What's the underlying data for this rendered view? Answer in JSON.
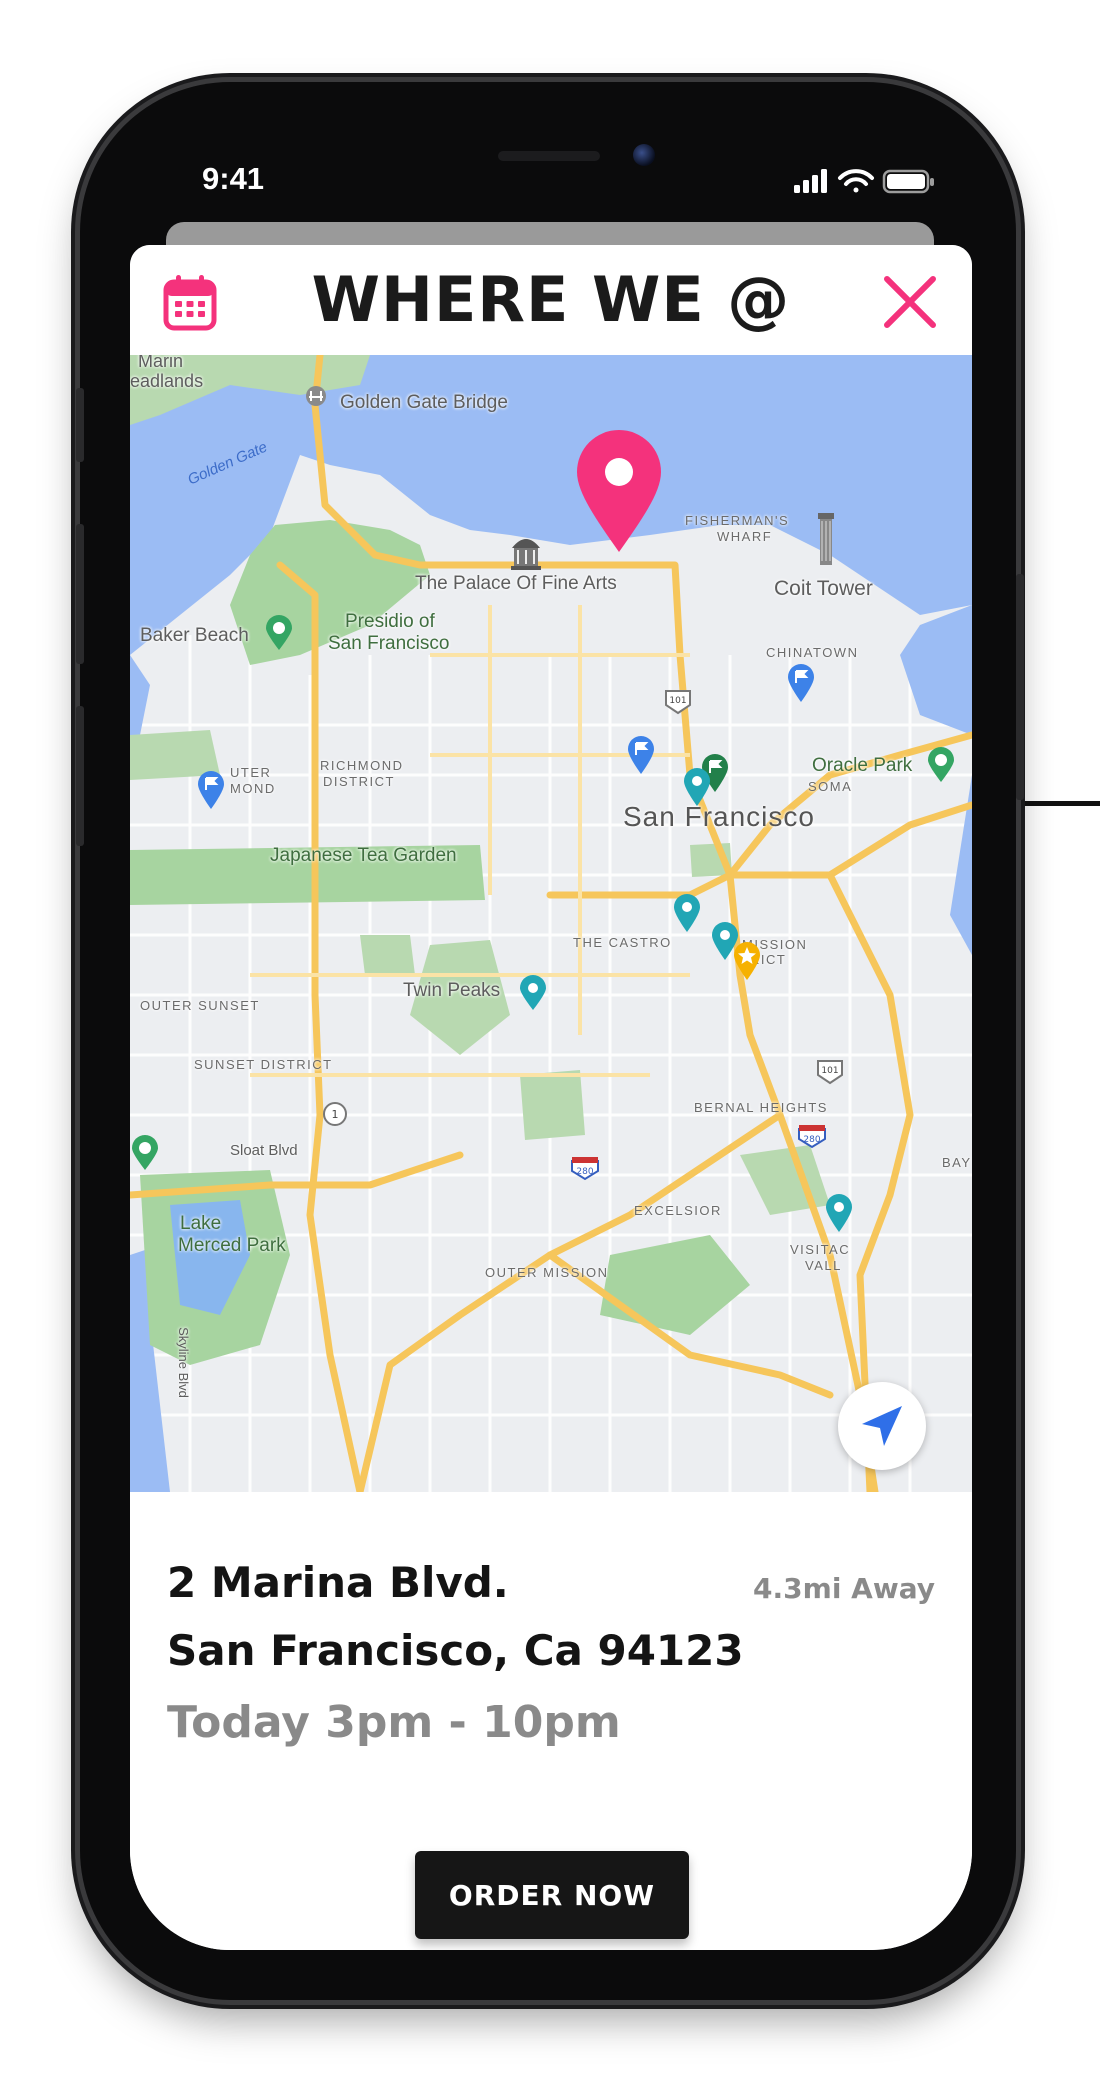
{
  "status_bar": {
    "time": "9:41"
  },
  "header": {
    "title": "WHERE WE @",
    "calendar_icon": "calendar-icon",
    "close_icon": "close-icon"
  },
  "colors": {
    "accent": "#f4327c",
    "text": "#141414",
    "muted": "#8a8a8a",
    "button": "#161616"
  },
  "map": {
    "labels": {
      "marin": "Marin",
      "headlands": "eadlands",
      "golden_gate_bridge": "Golden Gate Bridge",
      "golden_gate": "Golden Gate",
      "fishermans": "FISHERMAN'S",
      "wharf": "WHARF",
      "palace": "The Palace Of Fine Arts",
      "coit": "Coit Tower",
      "baker_beach": "Baker Beach",
      "presidio1": "Presidio of",
      "presidio2": "San Francisco",
      "chinatown": "CHINATOWN",
      "richmond1": "RICHMOND",
      "richmond2": "DISTRICT",
      "outer1": "UTER",
      "outer2": "MOND",
      "oracle": "Oracle Park",
      "soma": "SOMA",
      "city": "San Francisco",
      "japanese": "Japanese Tea Garden",
      "castro": "THE CASTRO",
      "mission1": "MISSION",
      "mission2": "RICT",
      "twin_peaks": "Twin Peaks",
      "outer_sunset": "OUTER SUNSET",
      "sunset_district": "SUNSET DISTRICT",
      "bernal": "BERNAL HEIGHTS",
      "sloat": "Sloat Blvd",
      "lake1": "Lake",
      "lake2": "Merced Park",
      "excelsior": "EXCELSIOR",
      "outer_mission": "OUTER MISSION",
      "visitac1": "VISITAC",
      "visitac2": "VALL",
      "skyline": "Skyline Blvd",
      "bay": "BAY",
      "hwy101a": "101",
      "hwy101b": "101",
      "hwy1": "1",
      "hwy280a": "280",
      "hwy280b": "280"
    },
    "locate_icon": "navigation-arrow-icon"
  },
  "location": {
    "address_line1": "2 Marina Blvd.",
    "address_line2": "San Francisco, Ca 94123",
    "hours": "Today 3pm - 10pm",
    "distance": "4.3mi Away"
  },
  "actions": {
    "order_label": "ORDER NOW"
  }
}
